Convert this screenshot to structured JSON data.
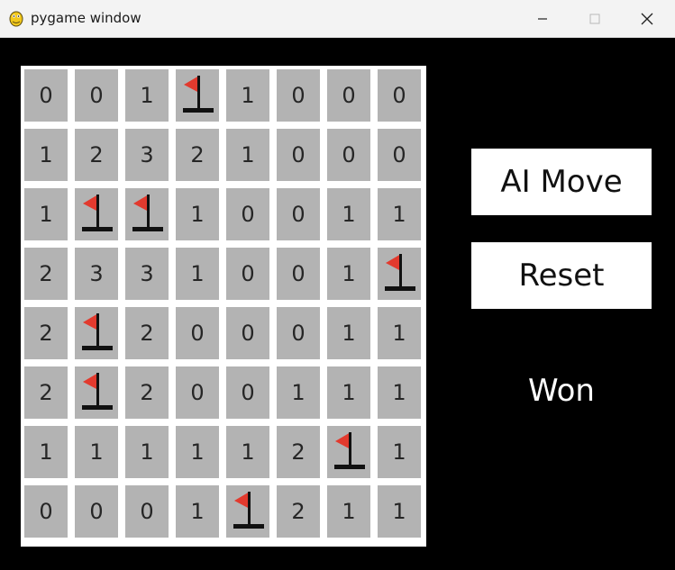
{
  "window": {
    "title": "pygame window",
    "minimize_symbol": "—",
    "close_symbol": "✕"
  },
  "board": {
    "rows": 8,
    "cols": 8,
    "cells": [
      [
        "0",
        "0",
        "1",
        "F",
        "1",
        "0",
        "0",
        "0"
      ],
      [
        "1",
        "2",
        "3",
        "2",
        "1",
        "0",
        "0",
        "0"
      ],
      [
        "1",
        "F",
        "F",
        "1",
        "0",
        "0",
        "1",
        "1"
      ],
      [
        "2",
        "3",
        "3",
        "1",
        "0",
        "0",
        "1",
        "F"
      ],
      [
        "2",
        "F",
        "2",
        "0",
        "0",
        "0",
        "1",
        "1"
      ],
      [
        "2",
        "F",
        "2",
        "0",
        "0",
        "1",
        "1",
        "1"
      ],
      [
        "1",
        "1",
        "1",
        "1",
        "1",
        "2",
        "F",
        "1"
      ],
      [
        "0",
        "0",
        "0",
        "1",
        "F",
        "2",
        "1",
        "1"
      ]
    ],
    "flag_code": "F",
    "colors": {
      "cell": "#b3b3b3",
      "grid": "#ffffff",
      "flag": "#e23a2e",
      "pole": "#111111"
    }
  },
  "controls": {
    "ai_move_label": "AI Move",
    "reset_label": "Reset"
  },
  "status": {
    "text": "Won"
  }
}
